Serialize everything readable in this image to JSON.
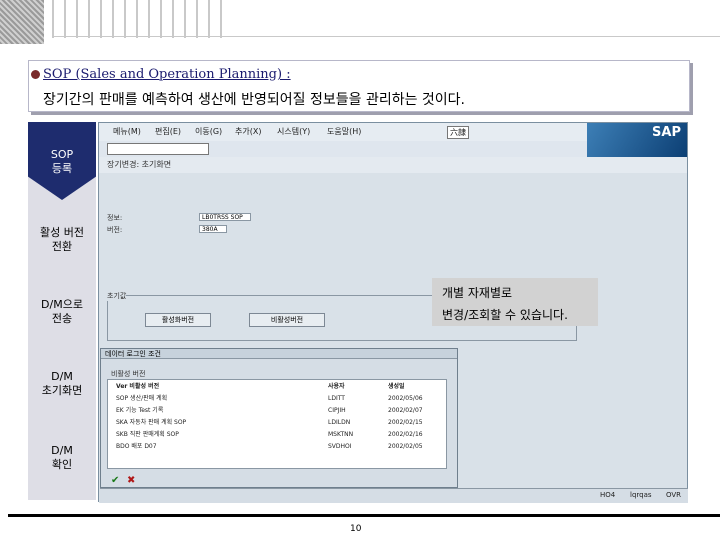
{
  "header": {
    "title": "SOP (Sales and Operation Planning) :",
    "subtitle": "장기간의 판매를 예측하여 생산에 반영되어질 정보들을 관리하는 것이다."
  },
  "steps": {
    "s1": "SOP\n등록",
    "s2": "활성 버전\n전환",
    "s3": "D/M으로\n전송",
    "s4": "D/M\n초기화면",
    "s5": "D/M\n확인"
  },
  "sap": {
    "logo": "SAP",
    "menu": [
      "메뉴(M)",
      "편집(E)",
      "이동(G)",
      "추가(X)",
      "시스템(Y)",
      "도움말(H)"
    ],
    "screen_title": "장기변경: 초기화면",
    "lang": "六隷",
    "labels": {
      "plant": "정보:",
      "version": "버전:"
    },
    "fields": {
      "plant": "LB0TRSS SOP",
      "version": "380A"
    },
    "group_title": "초기값",
    "btn_active": "활성화버전",
    "btn_inactive": "비활성버전",
    "dialog_title": "데이터 로그인 조건",
    "list_header": "비활성 버전",
    "rows": [
      {
        "code": "Ver 비활성 버전",
        "user": "사용자",
        "date": "생성일"
      },
      {
        "code": "SOP 생산/판매 계획",
        "user": "LDITT",
        "date": "2002/05/06"
      },
      {
        "code": "EK 기능 Test 기록",
        "user": "CIPJIH",
        "date": "2002/02/07"
      },
      {
        "code": "SKA 자동차 판매 계획 SOP",
        "user": "LDILDN",
        "date": "2002/02/15"
      },
      {
        "code": "SKB 직판 판매계획 SOP",
        "user": "MSKTNN",
        "date": "2002/02/16"
      },
      {
        "code": "BDO 배포 D07",
        "user": "SVDHOI",
        "date": "2002/02/05"
      }
    ],
    "status": {
      "session": "HO4",
      "client": "lqrqas",
      "mode": "OVR"
    }
  },
  "callout": {
    "line1": "개별 자재별로",
    "line2": "변경/조회할 수 있습니다."
  },
  "page": {
    "number": "10"
  }
}
